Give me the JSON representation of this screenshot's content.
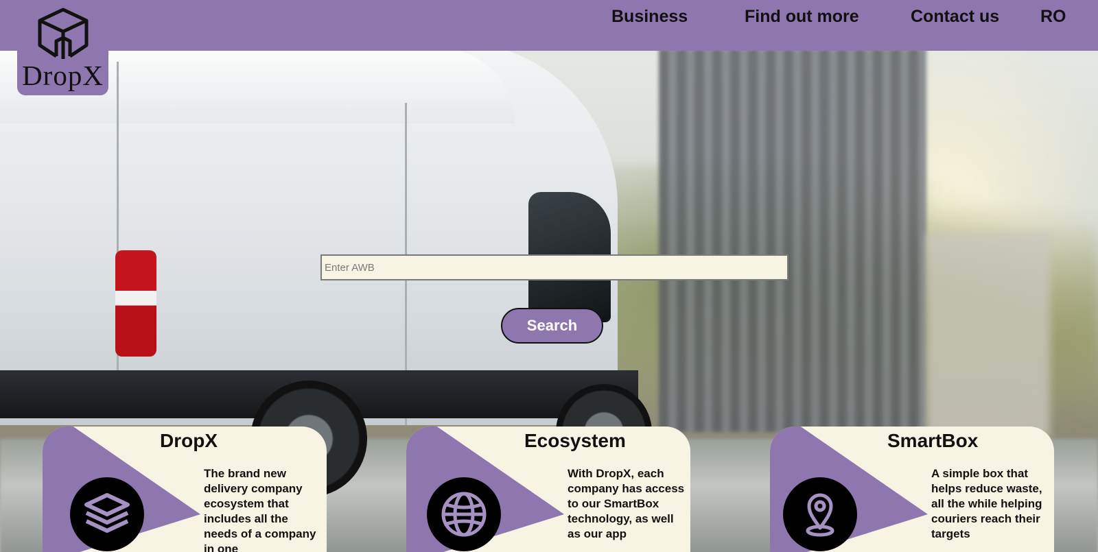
{
  "brand": {
    "name": "DropX"
  },
  "nav": {
    "items": [
      {
        "label": "Business"
      },
      {
        "label": "Find out more"
      },
      {
        "label": "Contact us"
      },
      {
        "label": "RO"
      }
    ]
  },
  "search": {
    "placeholder": "Enter AWB",
    "value": "",
    "button_label": "Search"
  },
  "cards": [
    {
      "title": "DropX",
      "icon": "layers-icon",
      "description": "The brand new delivery company ecosystem that includes all the needs of a company in one"
    },
    {
      "title": "Ecosystem",
      "icon": "globe-icon",
      "description": "With DropX, each company has access to our SmartBox technology, as well as our app"
    },
    {
      "title": "SmartBox",
      "icon": "location-pin-icon",
      "description": "A simple box that helps reduce waste, all the while helping couriers reach their targets"
    }
  ],
  "colors": {
    "accent": "#8e77ae",
    "card_background": "#f8f4e4",
    "icon_background": "#000000",
    "button_text": "#ffffff"
  }
}
